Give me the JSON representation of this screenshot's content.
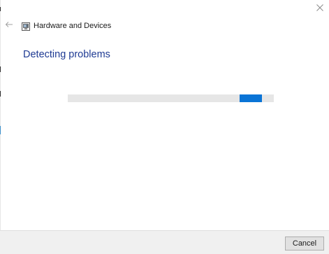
{
  "window": {
    "title": "Hardware and Devices",
    "app_icon": "hardware-troubleshooter-icon",
    "close_icon": "close-icon",
    "back_icon": "back-arrow-icon"
  },
  "main": {
    "heading": "Detecting problems",
    "progress": {
      "mode": "indeterminate",
      "color": "#0a74d6",
      "track_color": "#e6e6e6"
    }
  },
  "footer": {
    "cancel_label": "Cancel"
  },
  "colors": {
    "heading": "#1e3a93",
    "accent": "#0a74d6",
    "footer_bg": "#f0f0f0"
  }
}
